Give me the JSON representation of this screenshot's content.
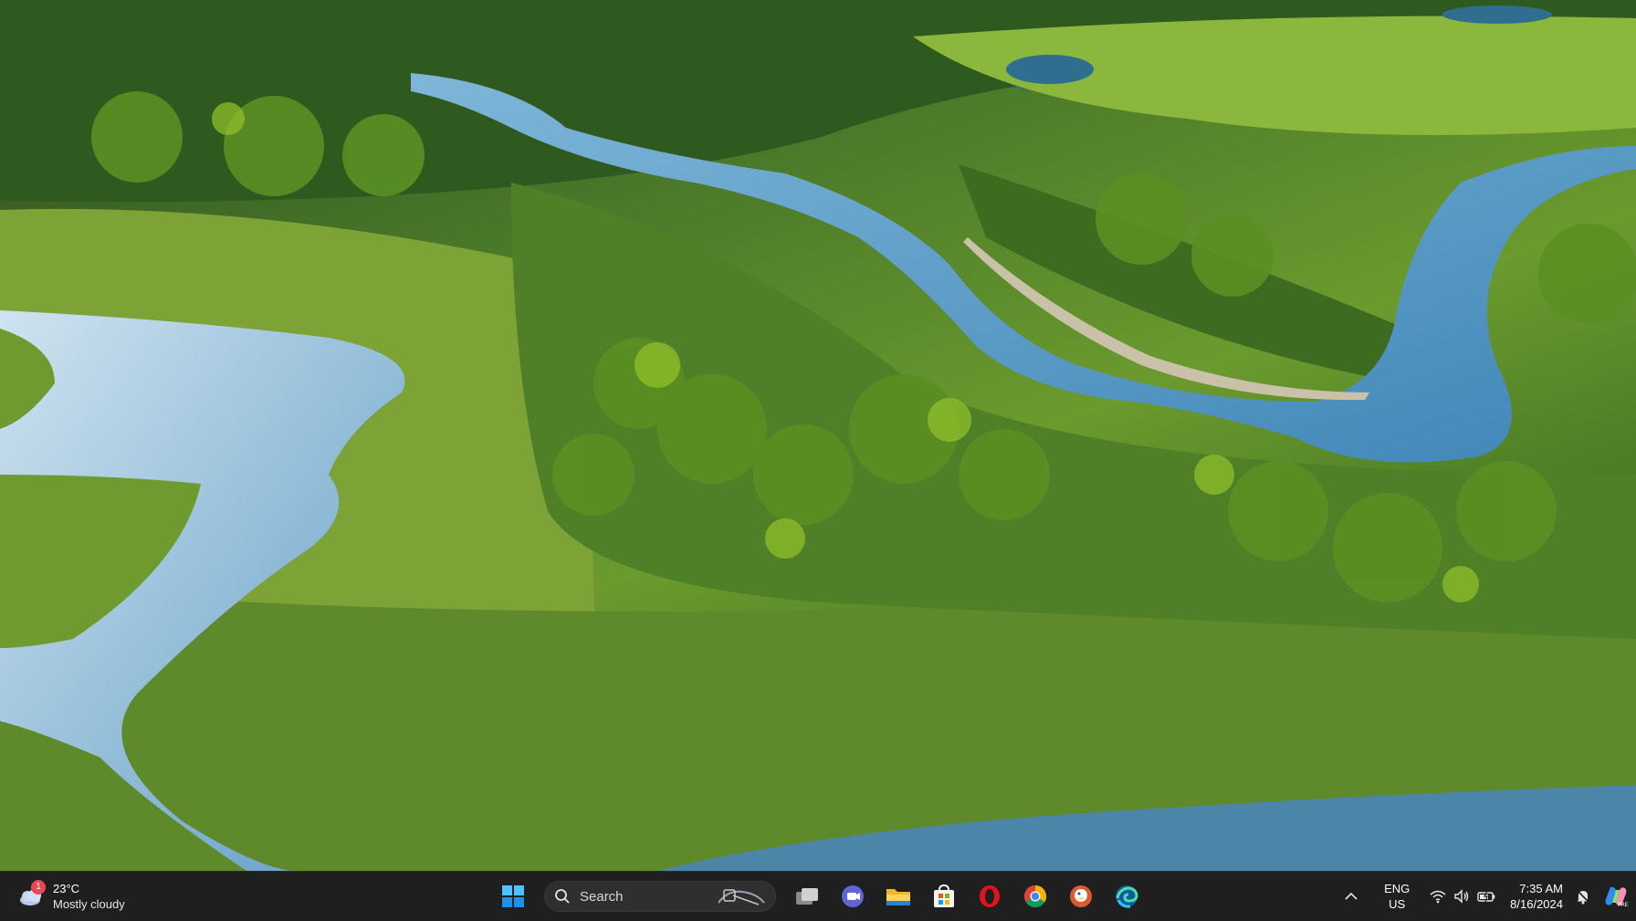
{
  "weather": {
    "badge": "1",
    "temperature": "23°C",
    "condition": "Mostly cloudy"
  },
  "search": {
    "label": "Search"
  },
  "taskbar_apps": [
    {
      "name": "start-menu-icon"
    },
    {
      "name": "task-view-icon"
    },
    {
      "name": "teams-chat-icon"
    },
    {
      "name": "file-explorer-icon"
    },
    {
      "name": "microsoft-store-icon"
    },
    {
      "name": "opera-icon"
    },
    {
      "name": "chrome-icon"
    },
    {
      "name": "duckduckgo-icon"
    },
    {
      "name": "edge-icon"
    }
  ],
  "tray": {
    "language_top": "ENG",
    "language_bottom": "US",
    "time": "7:35 AM",
    "date": "8/16/2024"
  },
  "colors": {
    "taskbar_bg": "#1f1f1f",
    "accent": "#0078d4"
  }
}
